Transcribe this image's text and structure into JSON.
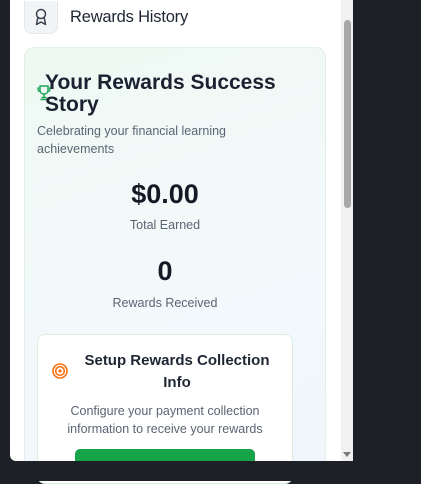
{
  "header": {
    "title": "Rewards History",
    "icon": "award-icon"
  },
  "summary": {
    "title": "Your Rewards Success Story",
    "subtitle": "Celebrating your financial learning achievements",
    "icon": "trophy-icon",
    "total_earned_value": "$0.00",
    "total_earned_label": "Total Earned",
    "rewards_received_value": "0",
    "rewards_received_label": "Rewards Received"
  },
  "setup": {
    "icon": "target-icon",
    "title": "Setup Rewards Collection Info",
    "description": "Configure your payment collection information to receive your rewards",
    "button_label": ""
  },
  "colors": {
    "accent_green": "#16a34a",
    "background_dark": "#1d2027",
    "target_orange": "#f97316"
  }
}
